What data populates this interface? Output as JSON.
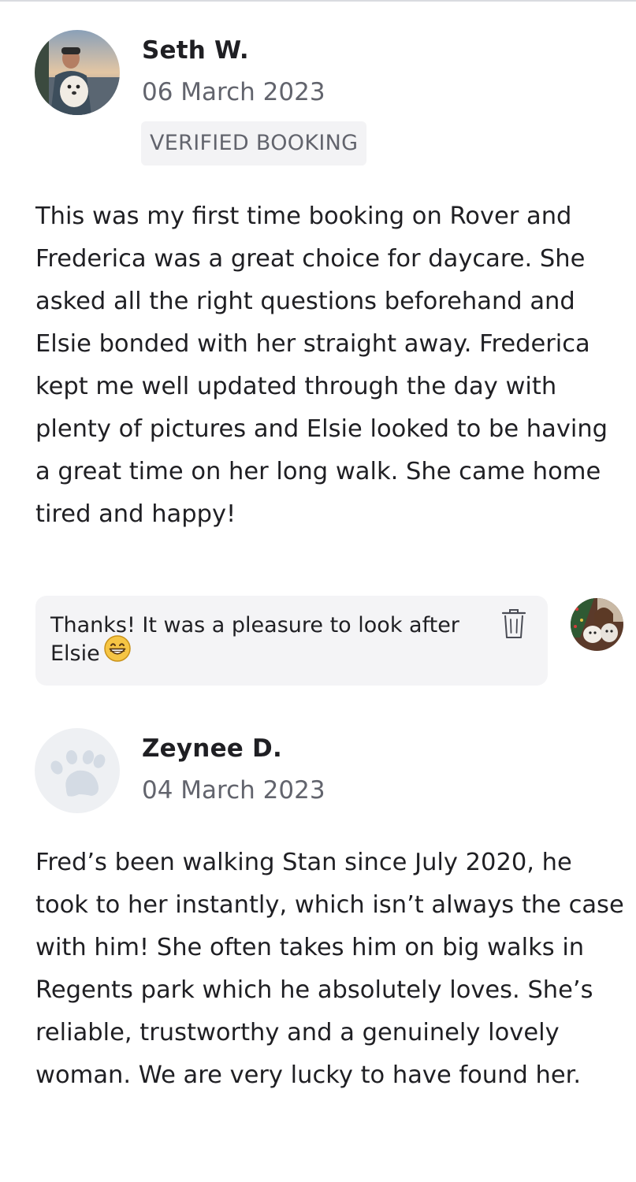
{
  "reviews": [
    {
      "reviewer_name": "Seth W.",
      "date": "06 March 2023",
      "badge": "VERIFIED BOOKING",
      "avatar_icon": "reviewer-photo-dog",
      "text": "This was my first time booking on Rover and Frederica was a great choice for daycare. She asked all the right questions beforehand and Elsie bonded with her straight away. Frederica kept me well updated through the day with plenty of pictures and Elsie looked to be having a great time on her long walk. She came home tired and happy!",
      "reply": {
        "text": "Thanks! It was a pleasure to look after Elsie",
        "emoji": "grinning-face-with-smiling-eyes",
        "delete_icon": "trash-icon",
        "sitter_avatar_icon": "sitter-photo-dogs"
      }
    },
    {
      "reviewer_name": "Zeynee D.",
      "date": "04 March 2023",
      "avatar_icon": "paw-icon",
      "text": "Fred’s been walking Stan since July 2020, he took to her instantly, which isn’t always the case with him! She often takes him on big walks in Regents park which he absolutely loves. She’s reliable, trustworthy and a genuinely lovely woman. We are very lucky to have found her."
    }
  ],
  "colors": {
    "text_primary": "#1f1f23",
    "text_secondary": "#62646d",
    "badge_bg": "#f3f3f5",
    "reply_bg": "#f4f4f6",
    "paw_avatar_bg": "#eef0f3",
    "paw_color": "#d4dbe4"
  }
}
